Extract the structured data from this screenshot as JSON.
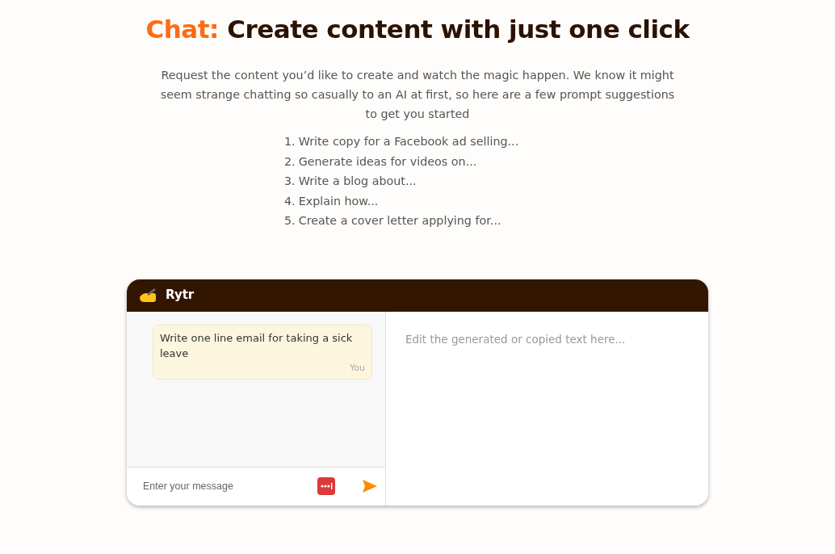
{
  "heading": {
    "accent": "Chat:",
    "text": "Create content with just one click"
  },
  "intro": "Request the content you’d like to create and watch the magic happen. We know it might seem strange chatting so casually to an AI at first, so here are a few prompt suggestions to get you started",
  "suggestions": [
    {
      "number": "1.",
      "text": "Write copy for a Facebook ad selling..."
    },
    {
      "number": "2.",
      "text": "Generate ideas for videos on..."
    },
    {
      "number": "3.",
      "text": "Write a blog about..."
    },
    {
      "number": "4.",
      "text": "Explain how..."
    },
    {
      "number": "5.",
      "text": "Create a cover letter applying for..."
    }
  ],
  "chat": {
    "app_name": "Rytr",
    "messages": [
      {
        "text": "Write one line email for taking a sick leave",
        "sender": "You"
      }
    ],
    "input": {
      "placeholder": "Enter your message"
    },
    "editor": {
      "placeholder": "Edit the generated or copied text here..."
    }
  }
}
